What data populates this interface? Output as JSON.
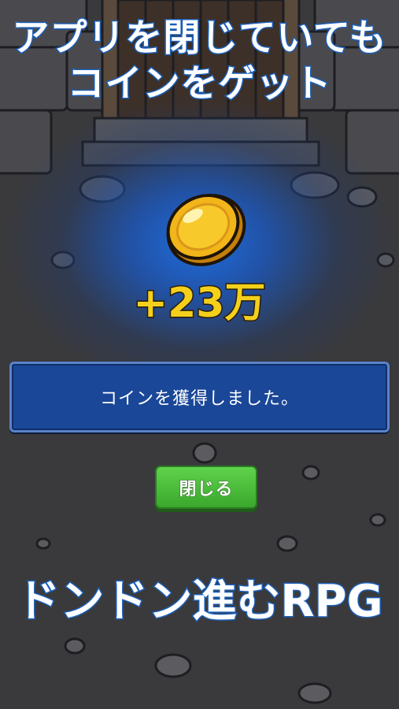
{
  "promo": {
    "top_line_1": "アプリを閉じていても",
    "top_line_2": "コインをゲット",
    "bottom_line": "ドンドン進むRPG"
  },
  "reward": {
    "amount": "+23万",
    "icon": "gold-coin-icon"
  },
  "dialog": {
    "message": "コインを獲得しました。",
    "close_label": "閉じる"
  },
  "colors": {
    "background": "#3b3b3d",
    "glow": "#1e6ee6",
    "panel": "#1a4797",
    "panel_border": "#5a83c8",
    "button": "#4cbe3a",
    "amount_text": "#f4d01c",
    "promo_stroke": "#1b5fb8"
  }
}
